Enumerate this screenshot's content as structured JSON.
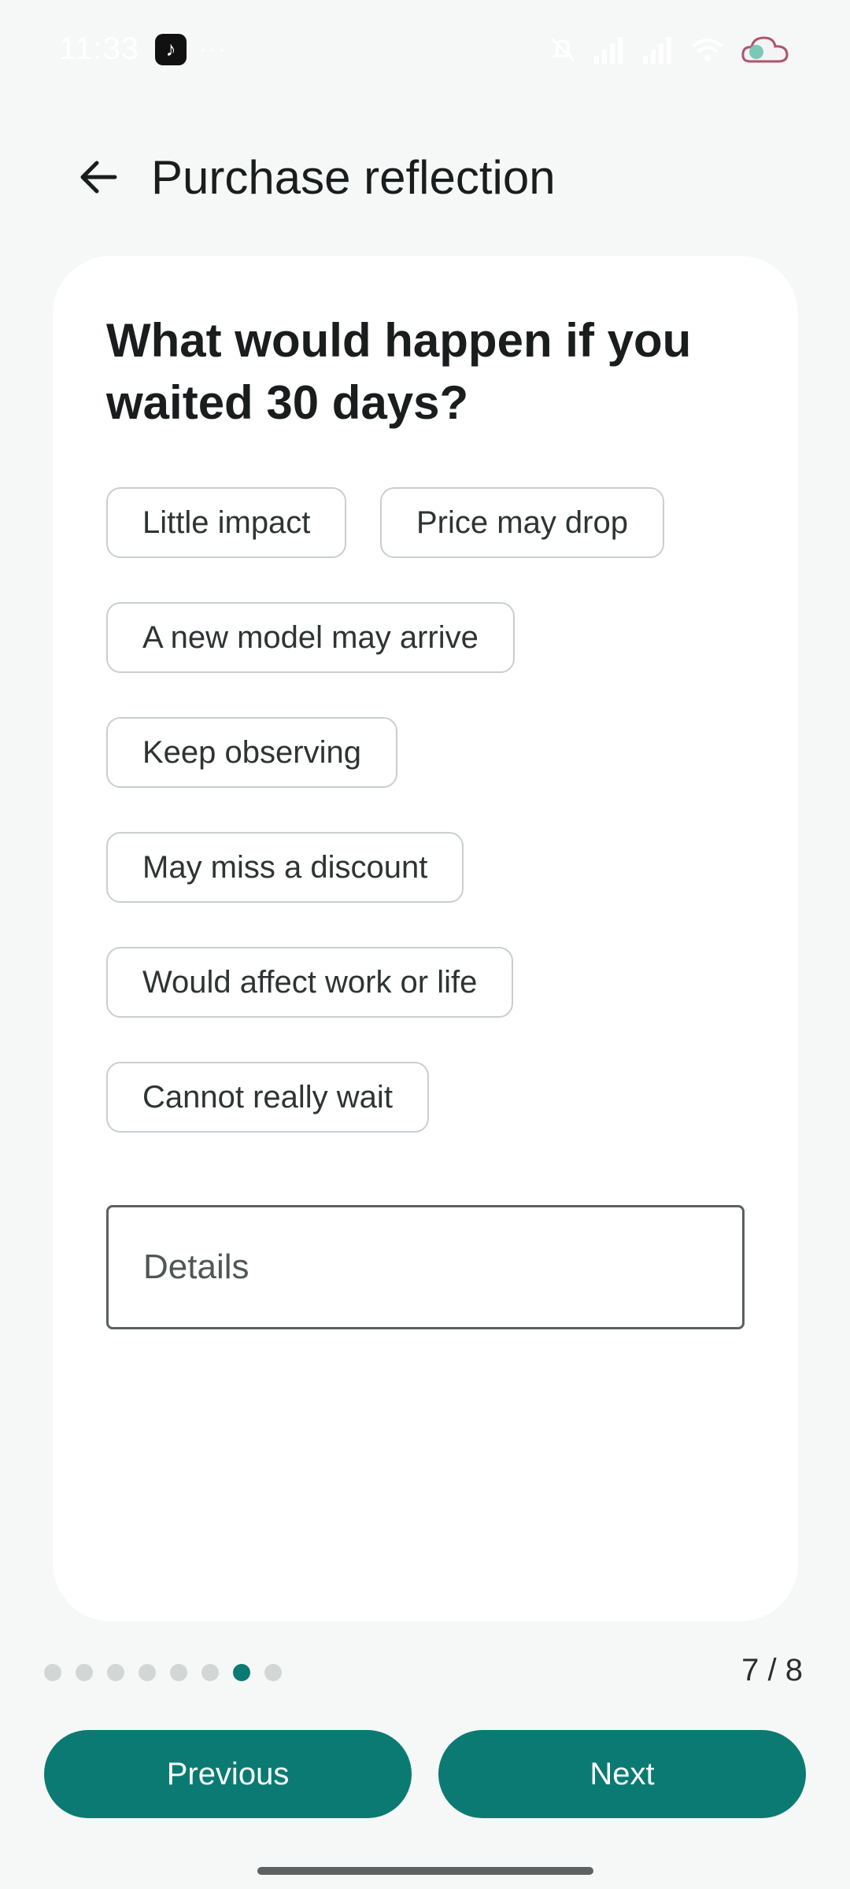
{
  "status_bar": {
    "time": "11:33",
    "app_badge": "♪",
    "more": "···",
    "icons": [
      "notification-off-icon",
      "signal-icon",
      "signal-icon",
      "wifi-icon",
      "weather-icon"
    ]
  },
  "header": {
    "title": "Purchase reflection",
    "back_icon": "arrow-left-icon"
  },
  "question": {
    "text": "What would happen if you waited 30 days?",
    "options": [
      "Little impact",
      "Price may drop",
      "A new model may arrive",
      "Keep observing",
      "May miss a discount",
      "Would affect work or life",
      "Cannot really wait"
    ],
    "details_placeholder": "Details"
  },
  "progress": {
    "total_steps": 8,
    "current_step": 7,
    "counter_label": "7 / 8"
  },
  "navigation": {
    "previous_label": "Previous",
    "next_label": "Next"
  },
  "colors": {
    "accent": "#0b7a73",
    "background": "#f5f8f7",
    "card": "#ffffff",
    "chip_border": "#c9cfcd"
  }
}
